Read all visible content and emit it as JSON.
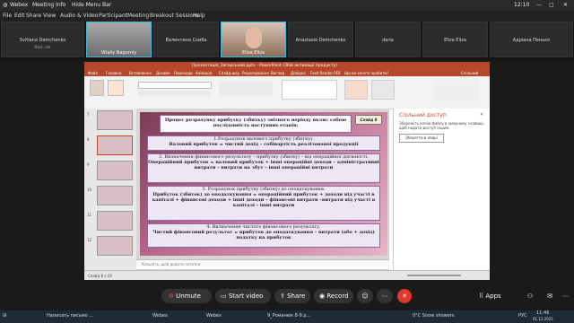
{
  "topbar": {
    "app": "Webex",
    "meeting_info": "Meeting Info",
    "hide_menu": "Hide Menu Bar",
    "time": "12:10"
  },
  "menubar": [
    "File",
    "Edit",
    "Share",
    "View",
    "Audio & Video",
    "Participant",
    "Meeting",
    "Breakout Sessions",
    "Help"
  ],
  "participants": [
    {
      "name": "Svitlana Demchenko",
      "sub": "Host, me"
    },
    {
      "name": "Vitaliy Nagorniy",
      "video": true
    },
    {
      "name": "Валентина Скиба"
    },
    {
      "name": "Eliza Ellza",
      "video": true
    },
    {
      "name": "Anastasia Demchenko"
    },
    {
      "name": "daria"
    },
    {
      "name": "Eliza Eliza"
    },
    {
      "name": "Адріана Пенько"
    }
  ],
  "ppt": {
    "title": "Презентація_Загорський.pptx - PowerPoint (Збій активації продукту)",
    "tabs": [
      "Файл",
      "Головна",
      "Вставлення",
      "Дизайн",
      "Переходи",
      "Анімація",
      "Слайд-шоу",
      "Рецензування",
      "Вигляд",
      "Довідка",
      "Foxit Reader PDF"
    ],
    "tell_me": "Що ви хочете зробити?",
    "share_btn": "Спільний доступ",
    "pane_title": "Спільний доступ",
    "pane_text": "Збережіть копію файлу в хмарному сховищі, щоб надати доступ іншим.",
    "pane_button": "Зберегти в хмарі",
    "status_left": "Слайд 8 з 19",
    "notes": "Клацніть, щоб додати нотатки",
    "slide_tag": "Слайд 8",
    "thumb_numbers": [
      "7",
      "8",
      "9",
      "10",
      "11",
      "12"
    ]
  },
  "slide": {
    "heading": "Процес розрахунку прибутку (збитку) звітного періоду вклю: собою послідовність наступних етапів:",
    "s1_title": "1.Розрахунок валового прибутку (збитку).",
    "s1_body": "Валовий прибуток = чистий дохід – собівартість реалізованої продукції",
    "s2_title": "2. Визначення фінансового результату – прибутку (збитку) – від операційної діяльності.",
    "s2_body": "Операційний прибуток = валовий прибуток + інші операційні доходи – адміністративні витрати – витрати на збут – інші операційні витрати",
    "s3_title": "3. Розрахунок прибутку (збитку) до оподаткування.",
    "s3_body": "Прибуток (збиток) до оподаткування = операційний прибуток + доходи від участі в капіталі + фінансові доходи + інші доходи – фінансові витрати –витрати від участі в капіталі – інші витрати",
    "s4_title": "4. Визначення чистого фінансового результату.",
    "s4_body": "Чистий фінансовий результат = прибуток до оподаткування – витрати (або + дохід) податку на прибуток"
  },
  "controls": {
    "unmute": "Unmute",
    "start_video": "Start video",
    "share": "Share",
    "record": "Record",
    "apps": "Apps"
  },
  "taskbar": {
    "items": [
      "Написать письмо ...",
      "Webex",
      "Webex",
      "9_Романюк 8-9.р..."
    ],
    "weather": "0°C Snow showers",
    "lang": "РУС",
    "clock": "11:46",
    "date": "01.12.2021"
  }
}
